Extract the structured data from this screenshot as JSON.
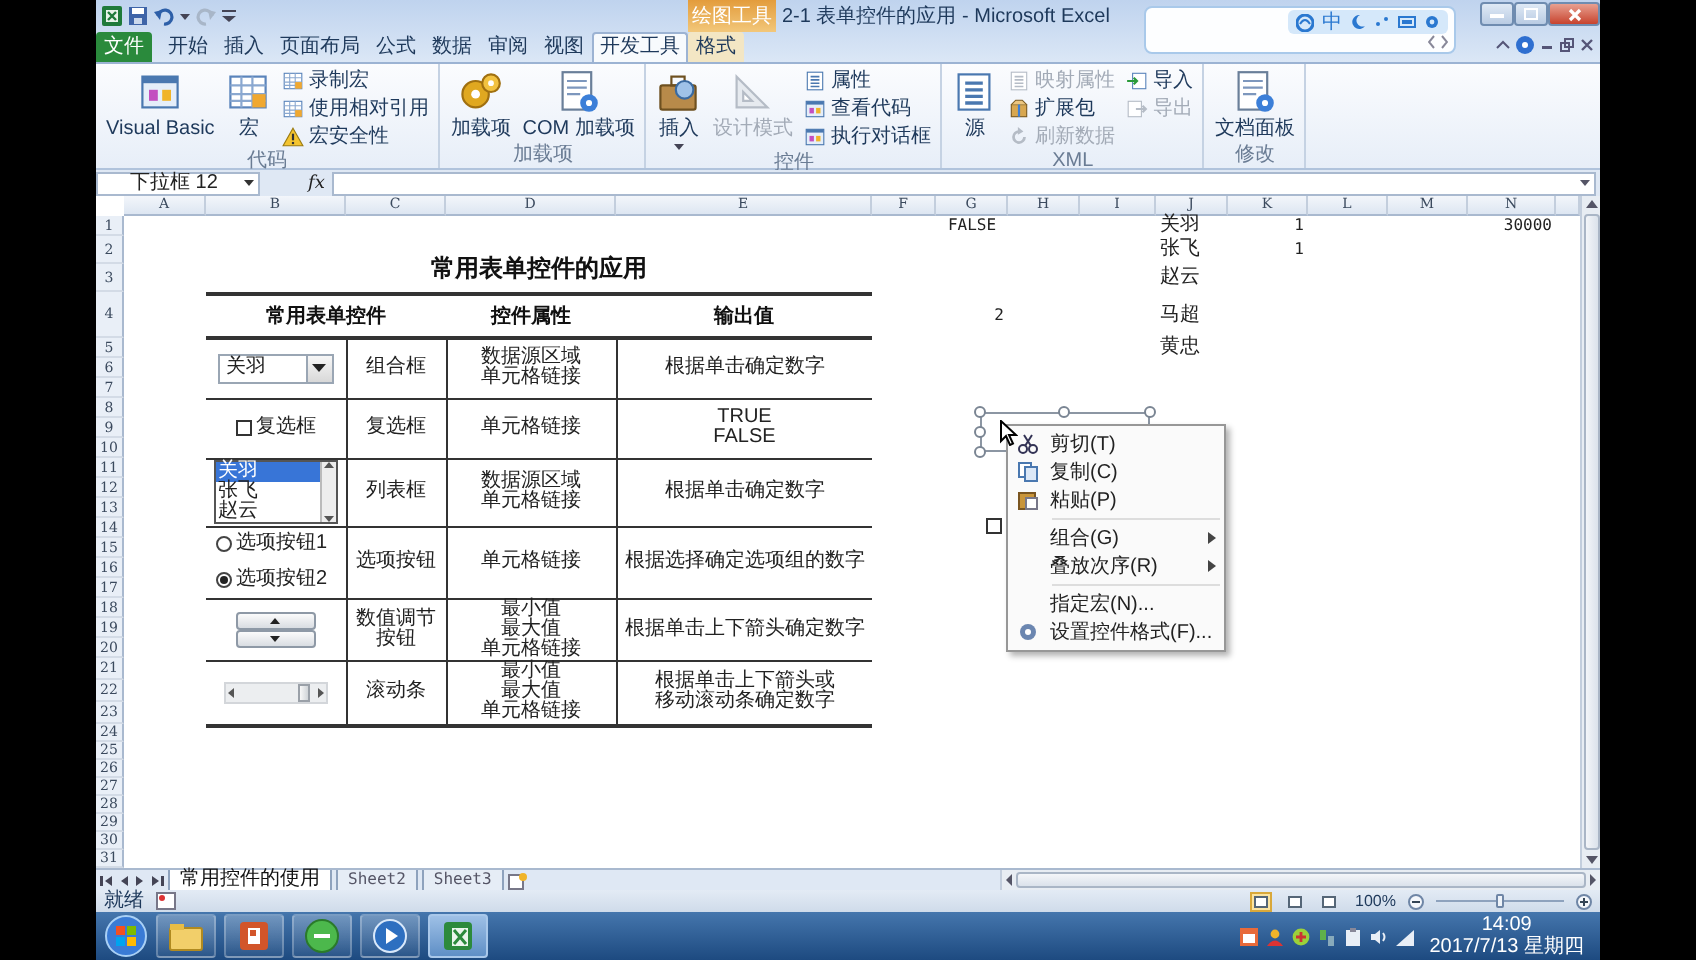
{
  "window": {
    "title": "2-1 表单控件的应用 - Microsoft Excel",
    "contextual_group": "绘图工具"
  },
  "ime_bar": {
    "mode": "中"
  },
  "ribbon": {
    "tabs": [
      {
        "label": "文件",
        "kind": "file",
        "selected": false
      },
      {
        "label": "开始",
        "kind": "normal",
        "selected": false
      },
      {
        "label": "插入",
        "kind": "normal",
        "selected": false
      },
      {
        "label": "页面布局",
        "kind": "normal",
        "selected": false
      },
      {
        "label": "公式",
        "kind": "normal",
        "selected": false
      },
      {
        "label": "数据",
        "kind": "normal",
        "selected": false
      },
      {
        "label": "审阅",
        "kind": "normal",
        "selected": false
      },
      {
        "label": "视图",
        "kind": "normal",
        "selected": false
      },
      {
        "label": "开发工具",
        "kind": "normal",
        "selected": true
      },
      {
        "label": "格式",
        "kind": "contextual",
        "selected": false
      }
    ],
    "groups": [
      {
        "name": "代码",
        "items": [
          {
            "label": "Visual Basic",
            "kind": "large",
            "disabled": false
          },
          {
            "label": "宏",
            "kind": "large",
            "disabled": false
          },
          {
            "label": "录制宏",
            "kind": "small",
            "disabled": false
          },
          {
            "label": "使用相对引用",
            "kind": "small",
            "disabled": false
          },
          {
            "label": "宏安全性",
            "kind": "small",
            "disabled": false
          }
        ]
      },
      {
        "name": "加载项",
        "items": [
          {
            "label": "加载项",
            "kind": "large",
            "disabled": false
          },
          {
            "label": "COM 加载项",
            "kind": "large",
            "disabled": false
          }
        ]
      },
      {
        "name": "控件",
        "items": [
          {
            "label": "插入",
            "kind": "large",
            "disabled": false,
            "menu": true
          },
          {
            "label": "设计模式",
            "kind": "large",
            "disabled": true
          },
          {
            "label": "属性",
            "kind": "small",
            "disabled": false
          },
          {
            "label": "查看代码",
            "kind": "small",
            "disabled": false
          },
          {
            "label": "执行对话框",
            "kind": "small",
            "disabled": false
          }
        ]
      },
      {
        "name": "XML",
        "items": [
          {
            "label": "源",
            "kind": "large",
            "disabled": false
          },
          {
            "label": "映射属性",
            "kind": "small",
            "disabled": true
          },
          {
            "label": "扩展包",
            "kind": "small",
            "disabled": false
          },
          {
            "label": "刷新数据",
            "kind": "small",
            "disabled": true
          },
          {
            "label": "导入",
            "kind": "small",
            "disabled": false
          },
          {
            "label": "导出",
            "kind": "small",
            "disabled": true
          }
        ]
      },
      {
        "name": "修改",
        "items": [
          {
            "label": "文档面板",
            "kind": "large",
            "disabled": false
          }
        ]
      }
    ]
  },
  "formula_bar": {
    "name_box": "下拉框 12",
    "fx": "fx"
  },
  "sheet": {
    "columns": [
      "A",
      "B",
      "C",
      "D",
      "E",
      "F",
      "G",
      "H",
      "I",
      "J",
      "K",
      "L",
      "M",
      "N"
    ],
    "rows": [
      "1",
      "2",
      "3",
      "4",
      "5",
      "6",
      "7",
      "8",
      "9",
      "10",
      "11",
      "12",
      "13",
      "14",
      "15",
      "16",
      "17",
      "18",
      "19",
      "20",
      "21",
      "22",
      "23",
      "24",
      "25",
      "26",
      "27",
      "28",
      "29",
      "30",
      "31"
    ],
    "title": "常用表单控件的应用",
    "table": {
      "headers": [
        "常用表单控件",
        "控件属性",
        "输出值"
      ],
      "rows": [
        {
          "control": {
            "kind": "combo",
            "value": "关羽"
          },
          "type": "组合框",
          "properties": [
            "数据源区域",
            "单元格链接"
          ],
          "output": [
            "根据单击确定数字"
          ]
        },
        {
          "control": {
            "kind": "checkbox",
            "label": "复选框",
            "checked": false
          },
          "type": "复选框",
          "properties": [
            "单元格链接"
          ],
          "output": [
            "TRUE",
            "FALSE"
          ]
        },
        {
          "control": {
            "kind": "listbox",
            "items": [
              {
                "label": "关羽",
                "selected": true
              },
              {
                "label": "张飞",
                "selected": false
              },
              {
                "label": "赵云",
                "selected": false
              }
            ]
          },
          "type": "列表框",
          "properties": [
            "数据源区域",
            "单元格链接"
          ],
          "output": [
            "根据单击确定数字"
          ]
        },
        {
          "control": {
            "kind": "radio",
            "options": [
              {
                "label": "选项按钮1",
                "selected": false
              },
              {
                "label": "选项按钮2",
                "selected": true
              }
            ]
          },
          "type": "选项按钮",
          "properties": [
            "单元格链接"
          ],
          "output": [
            "根据选择确定选项组的数字"
          ]
        },
        {
          "control": {
            "kind": "spinner"
          },
          "type": "数值调节按钮",
          "properties": [
            "最小值",
            "最大值",
            "单元格链接"
          ],
          "output": [
            "根据单击上下箭头确定数字"
          ]
        },
        {
          "control": {
            "kind": "scrollbar",
            "level": 0.8
          },
          "type": "滚动条",
          "properties": [
            "最小值",
            "最大值",
            "单元格链接"
          ],
          "output": [
            "根据单击上下箭头或移动滚动条确定数字"
          ]
        }
      ]
    },
    "cells": [
      {
        "G": "FALSE",
        "J": "关羽",
        "K": "1",
        "N": "30000"
      },
      {
        "J": "张飞",
        "K": "1"
      },
      {
        "J": "赵云"
      },
      {
        "G": "2",
        "J": "马超"
      },
      {
        "J": "黄忠"
      }
    ],
    "covered_checkbox": {
      "checked": false
    },
    "context_menu": [
      {
        "kind": "cut",
        "label": "剪切(T)"
      },
      {
        "kind": "copy",
        "label": "复制(C)"
      },
      {
        "kind": "paste",
        "label": "粘贴(P)"
      },
      {
        "kind": "separator"
      },
      {
        "kind": "submenu",
        "label": "组合(G)"
      },
      {
        "kind": "submenu",
        "label": "叠放次序(R)"
      },
      {
        "kind": "separator"
      },
      {
        "kind": "item",
        "label": "指定宏(N)..."
      },
      {
        "kind": "format",
        "label": "设置控件格式(F)..."
      }
    ]
  },
  "sheet_tabs": [
    {
      "label": "常用控件的使用",
      "selected": true
    },
    {
      "label": "Sheet2",
      "selected": false
    },
    {
      "label": "Sheet3",
      "selected": false
    }
  ],
  "status_bar": {
    "status": "就绪",
    "views": [
      {
        "selected": true
      },
      {
        "selected": false
      },
      {
        "selected": false
      }
    ],
    "zoom": "100%",
    "zoom_slider": {
      "level": 0.5
    }
  },
  "taskbar": {
    "apps": [
      {
        "selected": false
      },
      {
        "selected": false
      },
      {
        "selected": false
      },
      {
        "selected": false
      },
      {
        "selected": true
      }
    ],
    "time": "14:09",
    "date": "2017/7/13 星期四"
  }
}
